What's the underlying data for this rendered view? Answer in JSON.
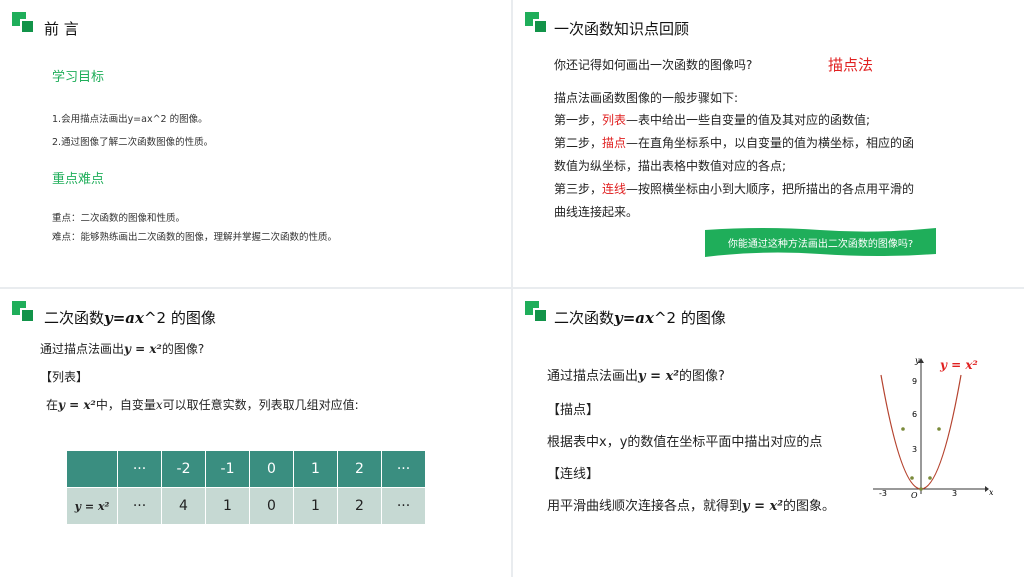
{
  "slide1": {
    "title": "前 言",
    "goal_heading": "学习目标",
    "goals": [
      "1.会用描点法画出y=ax^2 的图像。",
      "2.通过图像了解二次函数图像的性质。"
    ],
    "key_heading": "重点难点",
    "key_line": "重点：二次函数的图像和性质。",
    "hard_line": "难点：能够熟练画出二次函数的图像，理解并掌握二次函数的性质。"
  },
  "slide2": {
    "title": "一次函数知识点回顾",
    "question": "你还记得如何画出一次函数的图像吗?",
    "method": "描点法",
    "general": "描点法画函数图像的一般步骤如下:",
    "step1_prefix": "第一步，",
    "step1_key": "列表",
    "step1_rest": "—表中给出一些自变量的值及其对应的函数值;",
    "step2_prefix": "第二步，",
    "step2_key": "描点",
    "step2_rest": "—在直角坐标系中，以自变量的值为横坐标，相应的函",
    "step2_cont": "数值为纵坐标，描出表格中数值对应的各点;",
    "step3_prefix": "第三步，",
    "step3_key": "连线",
    "step3_rest": "—按照横坐标由小到大顺序，把所描出的各点用平滑的",
    "step3_cont": "曲线连接起来。",
    "banner": "你能通过这种方法画出二次函数的图像吗?"
  },
  "slide3": {
    "title_pre": "二次函数",
    "title_math": "y=ax",
    "title_post": "^2 的图像",
    "intro_pre": "通过描点法画出",
    "intro_math": "y = x²",
    "intro_post": "的图像?",
    "tag": "【列表】",
    "desc_pre": "在",
    "desc_math": "y = x²",
    "desc_mid": "中，自变量",
    "desc_var": "x",
    "desc_post": "可以取任意实数，列表取几组对应值:",
    "table": {
      "row1": [
        "",
        "···",
        "-2",
        "-1",
        "0",
        "1",
        "2",
        "···"
      ],
      "row2": [
        "y = x²",
        "···",
        "4",
        "1",
        "0",
        "1",
        "2",
        "···"
      ]
    }
  },
  "slide4": {
    "title_pre": "二次函数",
    "title_math": "y=ax",
    "title_post": "^2 的图像",
    "intro_pre": "通过描点法画出",
    "intro_math": "y = x²",
    "intro_post": "的图像?",
    "tag1": "【描点】",
    "line1": "根据表中x，y的数值在坐标平面中描出对应的点",
    "tag2": "【连线】",
    "line2_pre": "用平滑曲线顺次连接各点，就得到",
    "line2_math": "y = x²",
    "line2_post": "的图象。",
    "graph": {
      "label": "y = x²",
      "y_axis": "y",
      "x_axis": "x",
      "origin": "O",
      "y_ticks": [
        "9",
        "6",
        "3"
      ],
      "x_ticks": [
        "-3",
        "3"
      ]
    }
  }
}
